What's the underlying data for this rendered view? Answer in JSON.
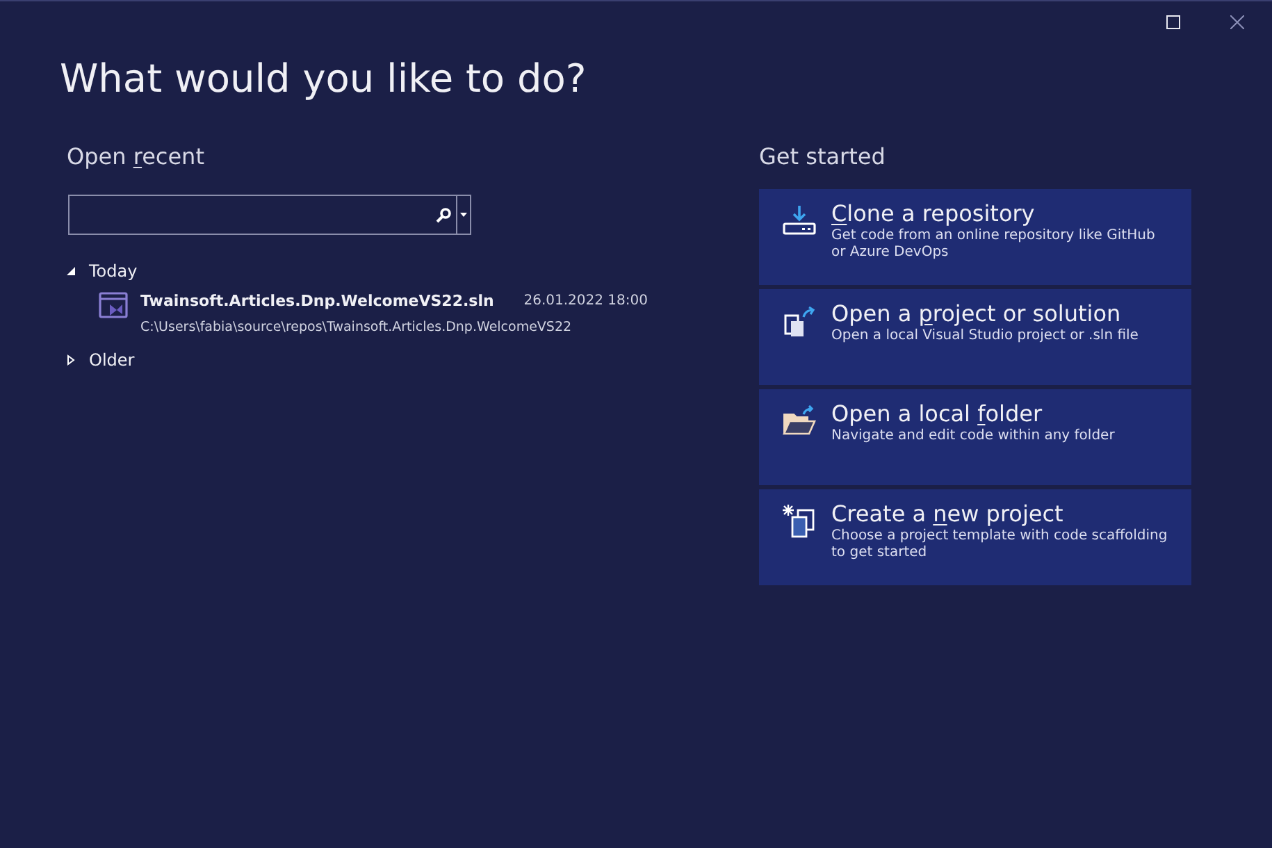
{
  "heading": "What would you like to do?",
  "open_recent": {
    "title_start": "Open ",
    "access_key": "r",
    "title_end": "ecent",
    "groups": [
      {
        "label": "Today",
        "expanded": true,
        "items": [
          {
            "name": "Twainsoft.Articles.Dnp.WelcomeVS22.sln",
            "date": "26.01.2022 18:00",
            "path": "C:\\Users\\fabia\\source\\repos\\Twainsoft.Articles.Dnp.WelcomeVS22"
          }
        ]
      },
      {
        "label": "Older",
        "expanded": false
      }
    ]
  },
  "get_started": {
    "title": "Get started",
    "actions": [
      {
        "kind": "clone",
        "access_key": "C",
        "title_end": "lone a repository",
        "description": "Get code from an online repository like GitHub or Azure DevOps"
      },
      {
        "kind": "open-project",
        "title_start": "Open a ",
        "access_key": "p",
        "title_end": "roject or solution",
        "description": "Open a local Visual Studio project or .sln file"
      },
      {
        "kind": "open-folder",
        "title_start": "Open a local ",
        "access_key": "f",
        "title_end": "older",
        "description": "Navigate and edit code within any folder"
      },
      {
        "kind": "new-project",
        "title_start": "Create a ",
        "access_key": "n",
        "title_end": "ew project",
        "description": "Choose a project template with code scaffolding to get started"
      }
    ]
  }
}
